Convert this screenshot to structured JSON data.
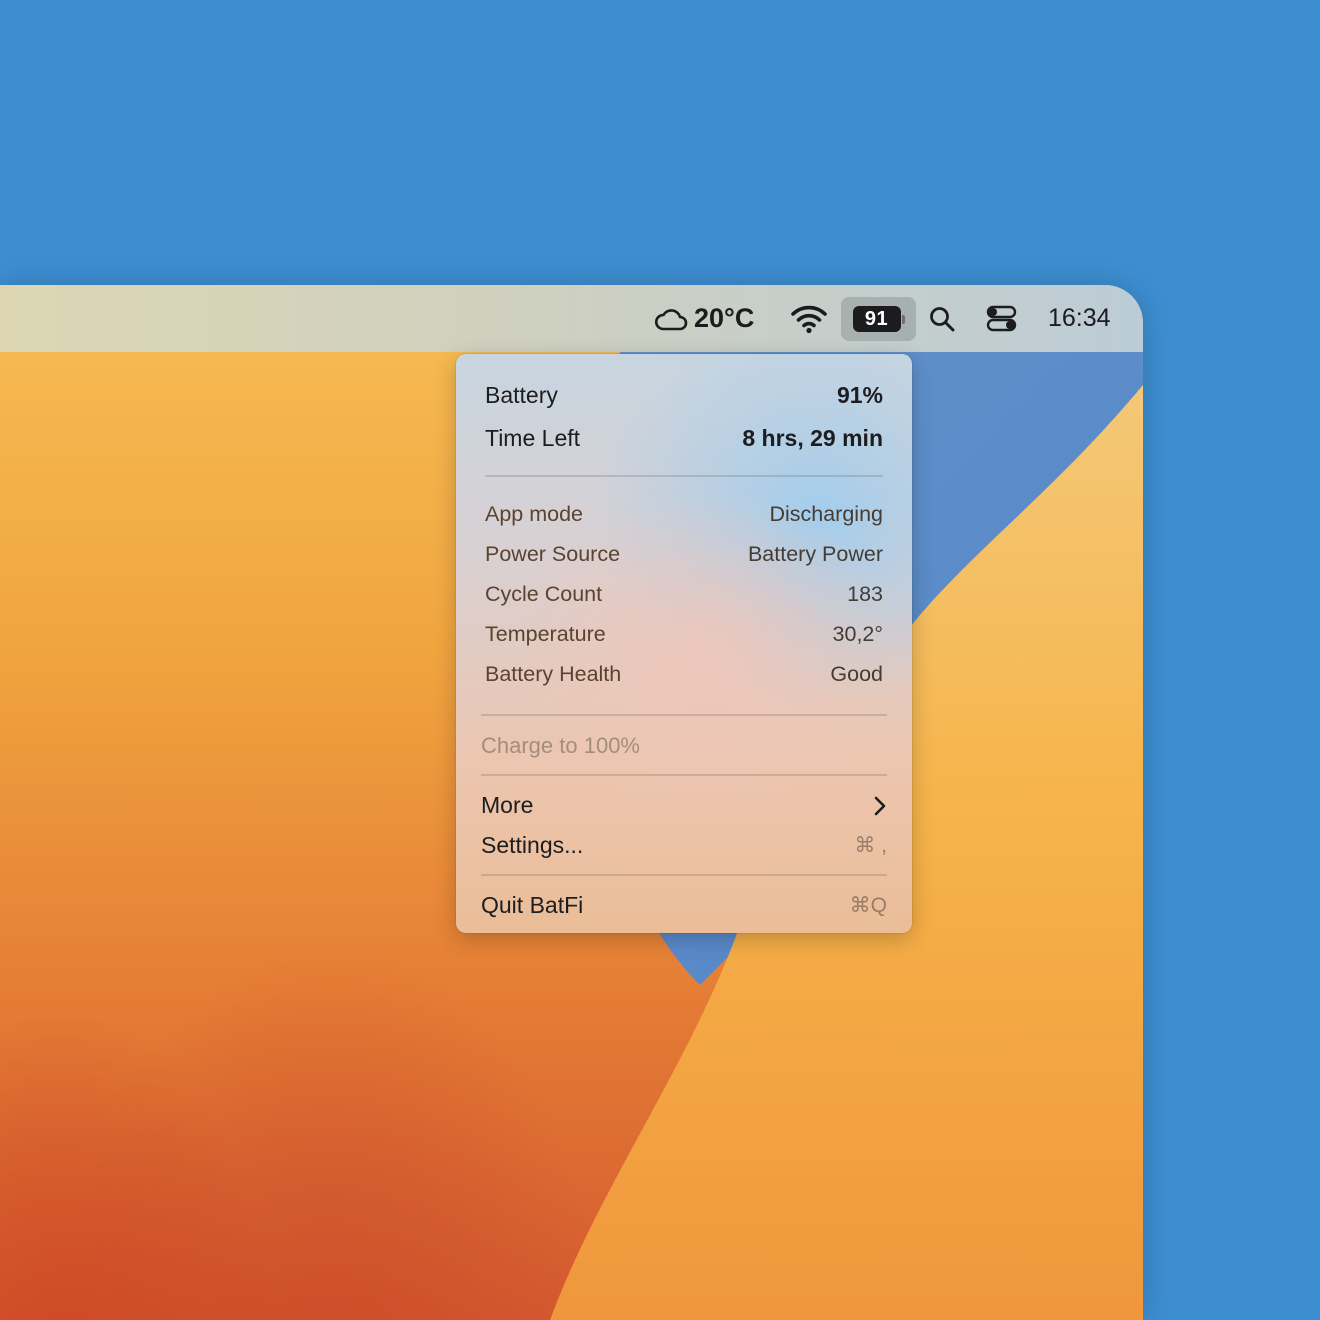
{
  "menubar": {
    "weather_icon": "cloud-icon",
    "temperature": "20°C",
    "wifi_icon": "wifi-icon",
    "battery_level": "91",
    "search_icon": "search-icon",
    "control_center_icon": "control-center-icon",
    "time": "16:34"
  },
  "menu": {
    "battery_label": "Battery",
    "battery_value": "91%",
    "time_left_label": "Time Left",
    "time_left_value": "8 hrs, 29 min",
    "details": [
      {
        "label": "App mode",
        "value": "Discharging"
      },
      {
        "label": "Power Source",
        "value": "Battery Power"
      },
      {
        "label": "Cycle Count",
        "value": "183"
      },
      {
        "label": "Temperature",
        "value": "30,2°"
      },
      {
        "label": "Battery Health",
        "value": "Good"
      }
    ],
    "charge_label": "Charge to 100%",
    "more_label": "More",
    "settings_label": "Settings...",
    "settings_shortcut": "⌘ ,",
    "quit_label": "Quit BatFi",
    "quit_shortcut": "⌘Q"
  }
}
